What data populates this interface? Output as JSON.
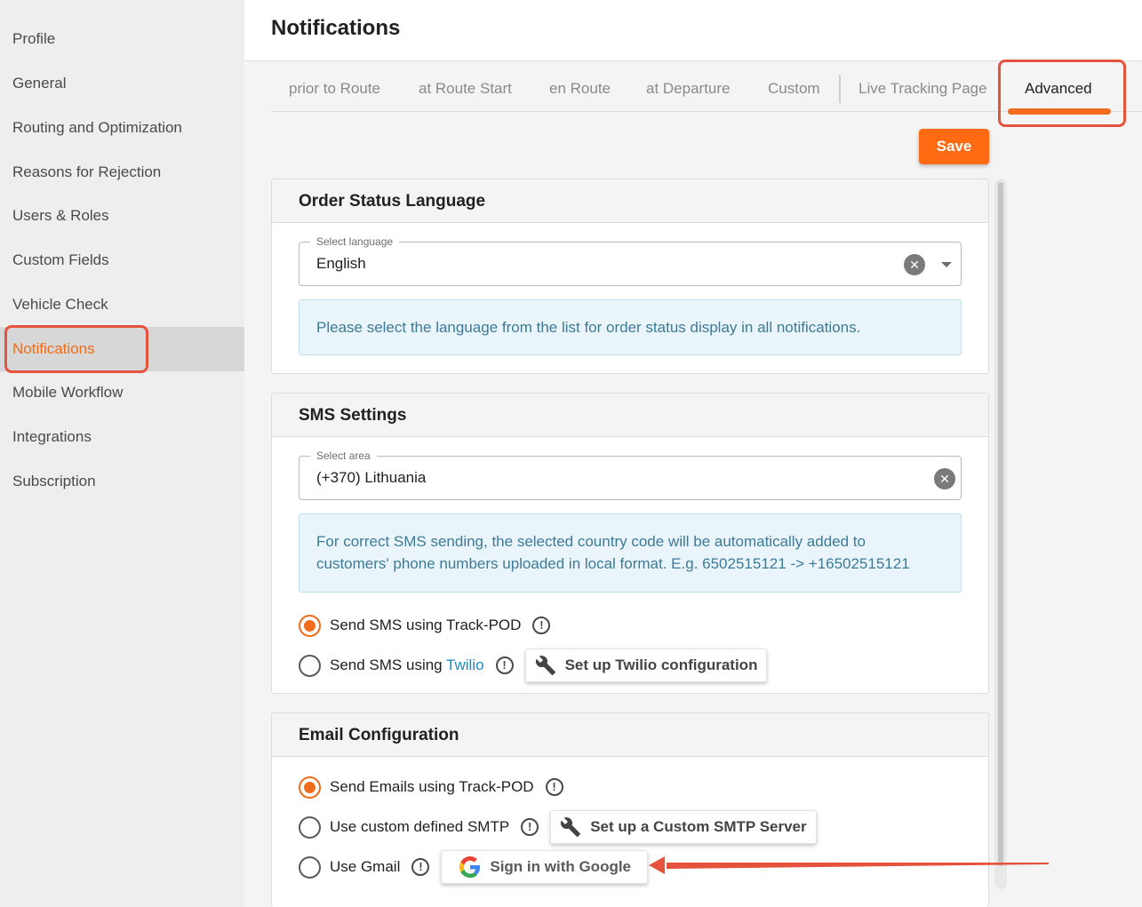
{
  "sidebar": {
    "items": [
      {
        "label": "Profile"
      },
      {
        "label": "General"
      },
      {
        "label": "Routing and Optimization"
      },
      {
        "label": "Reasons for Rejection"
      },
      {
        "label": "Users & Roles"
      },
      {
        "label": "Custom Fields"
      },
      {
        "label": "Vehicle Check"
      },
      {
        "label": "Notifications",
        "active": true
      },
      {
        "label": "Mobile Workflow"
      },
      {
        "label": "Integrations"
      },
      {
        "label": "Subscription"
      }
    ]
  },
  "header": {
    "title": "Notifications"
  },
  "tabs": [
    {
      "label": "prior to Route"
    },
    {
      "label": "at Route Start"
    },
    {
      "label": "en Route"
    },
    {
      "label": "at Departure"
    },
    {
      "label": "Custom"
    },
    {
      "label": "Live Tracking Page"
    },
    {
      "label": "Advanced",
      "active": true
    }
  ],
  "toolbar": {
    "save_label": "Save"
  },
  "order_status_language": {
    "title": "Order Status Language",
    "field_label": "Select language",
    "value": "English",
    "info": "Please select the language from the list for order status display in all notifications."
  },
  "sms_settings": {
    "title": "SMS Settings",
    "field_label": "Select area",
    "value": "(+370) Lithuania",
    "info_line1": "For correct SMS sending, the selected country code will be automatically added to",
    "info_line2": "customers' phone numbers uploaded in local format. E.g. 6502515121 -> +16502515121",
    "option_trackpod": "Send SMS using Track-POD",
    "option_twilio_prefix": "Send SMS using ",
    "option_twilio_link": "Twilio",
    "twilio_button": "Set up Twilio configuration",
    "selected": "trackpod"
  },
  "email_configuration": {
    "title": "Email Configuration",
    "option_trackpod": "Send Emails using Track-POD",
    "option_smtp": "Use custom defined SMTP",
    "smtp_button": "Set up a Custom SMTP Server",
    "option_gmail": "Use Gmail",
    "gmail_button": "Sign in with Google",
    "selected": "trackpod"
  },
  "icons": {
    "info": "!",
    "clear": "✕"
  },
  "colors": {
    "accent": "#ff6a13",
    "annotation": "#e5533d",
    "info_text": "#3e7a97",
    "link": "#1a8ac4"
  }
}
